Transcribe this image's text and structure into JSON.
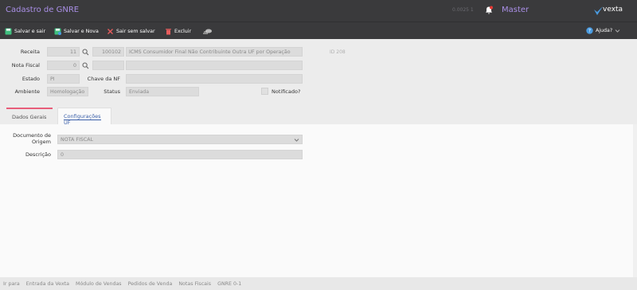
{
  "app": {
    "title": "Cadastro de GNRE",
    "code": "0.0025 1",
    "user": "Master",
    "logo_text": "vexta"
  },
  "toolbar": {
    "save_exit": "Salvar e sair",
    "save_new": "Salvar e Nova",
    "exit_nosave": "Sair sem salvar",
    "delete": "Excluir",
    "help": "Ajuda?"
  },
  "form": {
    "receita_label": "Receita",
    "receita_value": "11",
    "receita_code": "100102",
    "receita_desc": "ICMS Consumidor Final Não Contribuinte Outra UF por Operação",
    "id_text": "ID 208",
    "nota_label": "Nota Fiscal",
    "nota_value": "0",
    "estado_label": "Estado",
    "estado_value": "PI",
    "chave_label": "Chave da NF",
    "chave_value": "",
    "ambiente_label": "Ambiente",
    "ambiente_value": "Homologação",
    "status_label": "Status",
    "status_value": "Enviada",
    "notificado_label": "Notificado?"
  },
  "tabs": [
    {
      "label": "Dados Gerais"
    },
    {
      "label": "Configurações UF"
    }
  ],
  "config": {
    "doc_label_1": "Documento de",
    "doc_label_2": "Origem",
    "doc_value": "NOTA FISCAL",
    "desc_label": "Descrição",
    "desc_value": "0"
  },
  "footer": {
    "crumbs": [
      "Ir para",
      "Entrada da Vexta",
      "Módulo de Vendas",
      "Pedidos de Venda",
      "Notas Fiscais",
      "GNRE 0-1"
    ]
  },
  "colors": {
    "accent": "#a98fe6",
    "bar": "#3a3a3c",
    "tab_active": "#3a5fa8",
    "tab_marker": "#e85d7a"
  }
}
